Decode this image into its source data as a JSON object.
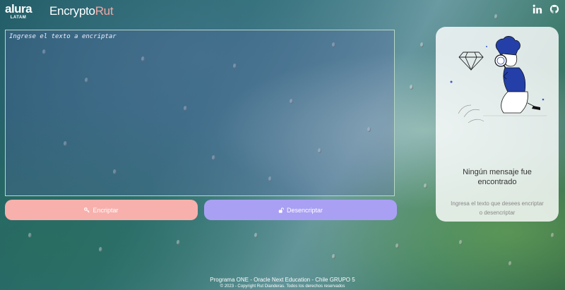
{
  "logo": {
    "line1": "alura",
    "line2": "LATAM"
  },
  "brand": {
    "prefix": "Encrypto",
    "accent": "Rut"
  },
  "social": {
    "linkedin": "linkedin-icon",
    "github": "github-icon"
  },
  "input": {
    "placeholder": "Ingrese el texto a encriptar",
    "value": ""
  },
  "buttons": {
    "encrypt": {
      "label": "Encriptar",
      "icon": "key-icon"
    },
    "decrypt": {
      "label": "Desencriptar",
      "icon": "unlock-icon"
    }
  },
  "panel": {
    "title": "Ningún mensaje fue encontrado",
    "subtitle": "Ingresa el texto que desees encriptar o desencriptar"
  },
  "footer": {
    "line1": "Programa ONE - Oracle Next Education - Chile GRUPO 5",
    "line2": "© 2023 - Copyright Rut Dianderas. Todos los derechos reservados"
  },
  "colors": {
    "encrypt": "#f7b0ac",
    "decrypt": "#a9a0f3",
    "accent": "#f4a7a3"
  }
}
